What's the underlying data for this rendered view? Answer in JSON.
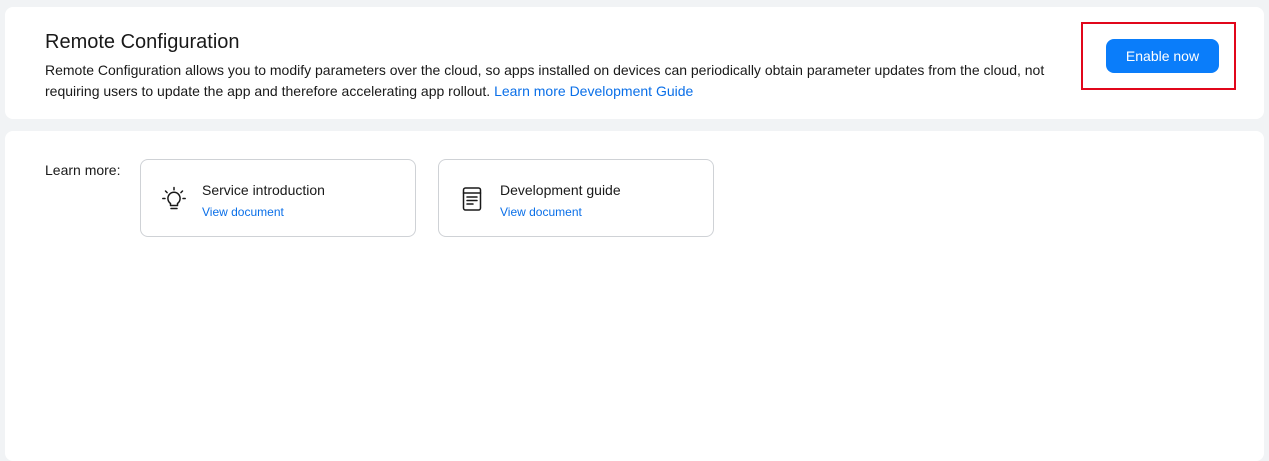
{
  "header": {
    "title": "Remote Configuration",
    "description": "Remote Configuration allows you to modify parameters over the cloud, so apps installed on devices can periodically obtain parameter updates from the cloud, not requiring users to update the app and therefore accelerating app rollout.",
    "learn_more_link": "Learn more",
    "dev_guide_link": "Development Guide",
    "enable_button": "Enable now"
  },
  "learn": {
    "label": "Learn more:",
    "cards": [
      {
        "title": "Service introduction",
        "link": "View document",
        "icon": "lightbulb-icon"
      },
      {
        "title": "Development guide",
        "link": "View document",
        "icon": "document-icon"
      }
    ]
  },
  "colors": {
    "accent": "#0a7dfa",
    "link": "#0a6fe8",
    "highlight": "#e1061b"
  }
}
